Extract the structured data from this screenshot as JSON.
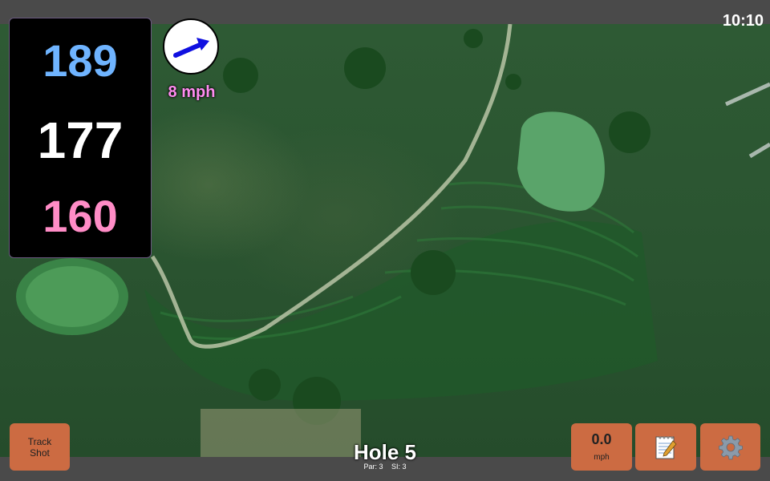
{
  "clock": {
    "time": "10:10"
  },
  "yardages": {
    "back": "189",
    "middle": "177",
    "front": "160"
  },
  "wind": {
    "speed_label": "8 mph",
    "icon": "wind-direction-arrow-icon"
  },
  "track_shot": {
    "line1": "Track",
    "line2": "Shot"
  },
  "speed_button": {
    "value": "0.0",
    "unit": "mph"
  },
  "notes_button": {
    "icon": "notepad-icon"
  },
  "settings_button": {
    "icon": "gear-icon"
  },
  "hole": {
    "title": "Hole 5",
    "par": "Par: 3",
    "si": "SI: 3"
  },
  "colors": {
    "back_yardage": "#6fb4ff",
    "middle_yardage": "#ffffff",
    "front_yardage": "#ff8cc6",
    "button": "#cc6b42",
    "wind_label": "#ff8cf0"
  }
}
